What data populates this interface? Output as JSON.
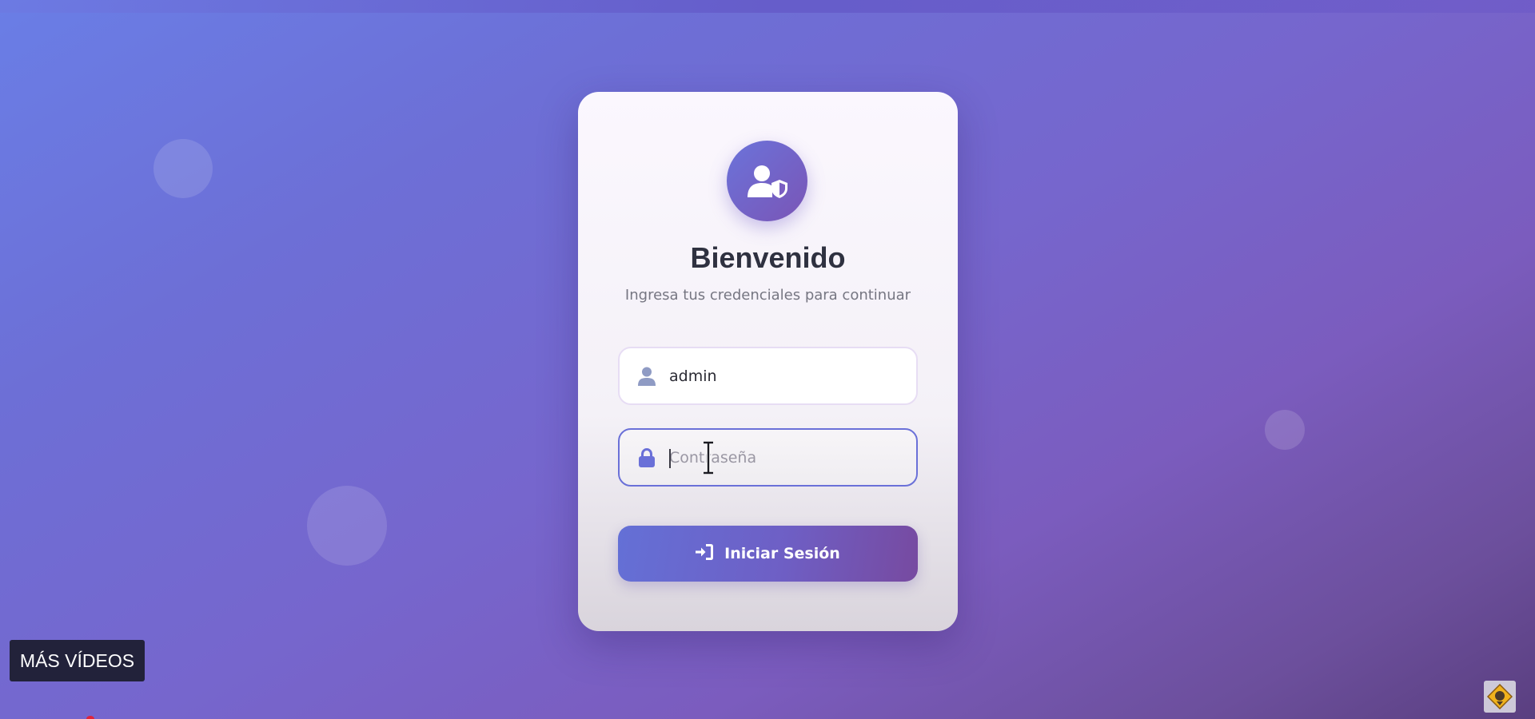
{
  "login": {
    "title": "Bienvenido",
    "subtitle": "Ingresa tus credenciales para continuar",
    "username": {
      "value": "admin",
      "icon": "user-icon"
    },
    "password": {
      "value": "",
      "placeholder": "Contraseña",
      "icon": "lock-icon",
      "focused": true
    },
    "submit": {
      "label": "Iniciar Sesión",
      "icon": "sign-in-icon"
    },
    "avatar_icon": "user-shield-icon"
  },
  "overlay": {
    "more_videos_label": "MÁS VÍDEOS",
    "watermark_icon": "channel-logo-icon"
  },
  "colors": {
    "accent_start": "#6470d6",
    "accent_end": "#774aa0",
    "background_start": "#6a7ee6",
    "background_end": "#5a3f80",
    "title_color": "#2f3140",
    "field_icon": "#8f9bc4",
    "lock_icon": "#6a70d8"
  }
}
